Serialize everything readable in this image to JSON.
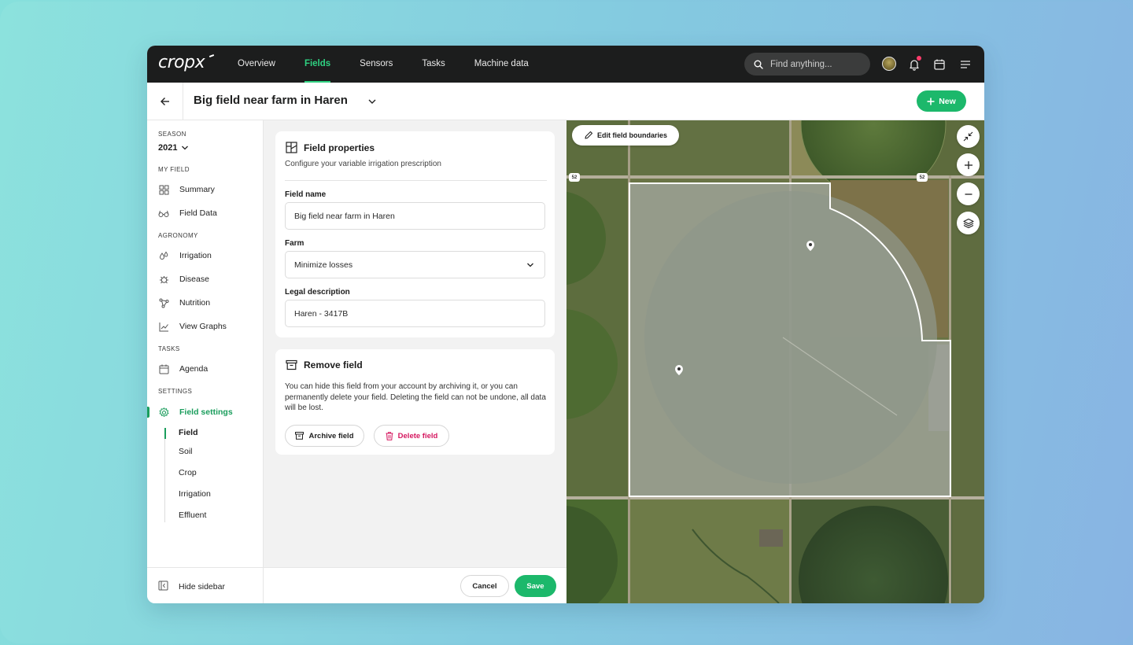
{
  "brand": {
    "logo_text": "cropx",
    "accent": "#1cb86b"
  },
  "nav": {
    "tabs": [
      {
        "label": "Overview",
        "active": false
      },
      {
        "label": "Fields",
        "active": true
      },
      {
        "label": "Sensors",
        "active": false
      },
      {
        "label": "Tasks",
        "active": false
      },
      {
        "label": "Machine data",
        "active": false
      }
    ],
    "search_placeholder": "Find anything..."
  },
  "header": {
    "title": "Big field near farm in Haren",
    "new_label": "New"
  },
  "sidebar": {
    "season_label": "SEASON",
    "season_value": "2021",
    "my_field_label": "MY FIELD",
    "summary": "Summary",
    "field_data": "Field Data",
    "agronomy_label": "AGRONOMY",
    "irrigation": "Irrigation",
    "disease": "Disease",
    "nutrition": "Nutrition",
    "view_graphs": "View Graphs",
    "tasks_label": "TASKS",
    "agenda": "Agenda",
    "settings_label": "SETTINGS",
    "field_settings": "Field settings",
    "sub": {
      "field": "Field",
      "soil": "Soil",
      "crop": "Crop",
      "irrigation": "Irrigation",
      "effluent": "Effluent"
    },
    "hide_sidebar": "Hide sidebar"
  },
  "field_properties": {
    "title": "Field properties",
    "subtitle": "Configure your variable irrigation prescription",
    "field_name_label": "Field name",
    "field_name_value": "Big field near farm in Haren",
    "farm_label": "Farm",
    "farm_value": "Minimize losses",
    "legal_label": "Legal description",
    "legal_value": "Haren - 3417B"
  },
  "remove_field": {
    "title": "Remove field",
    "text": "You can hide this field from your account by archiving it, or you can permanently delete your field. Deleting the field can not be undone, all data will be lost.",
    "archive_label": "Archive field",
    "delete_label": "Delete field"
  },
  "footer": {
    "cancel_label": "Cancel",
    "save_label": "Save"
  },
  "map": {
    "edit_label": "Edit field boundaries",
    "road_sign_1": "52",
    "road_sign_2": "52",
    "icons": [
      "collapse-icon",
      "zoom-in-icon",
      "zoom-out-icon",
      "layers-icon"
    ]
  }
}
